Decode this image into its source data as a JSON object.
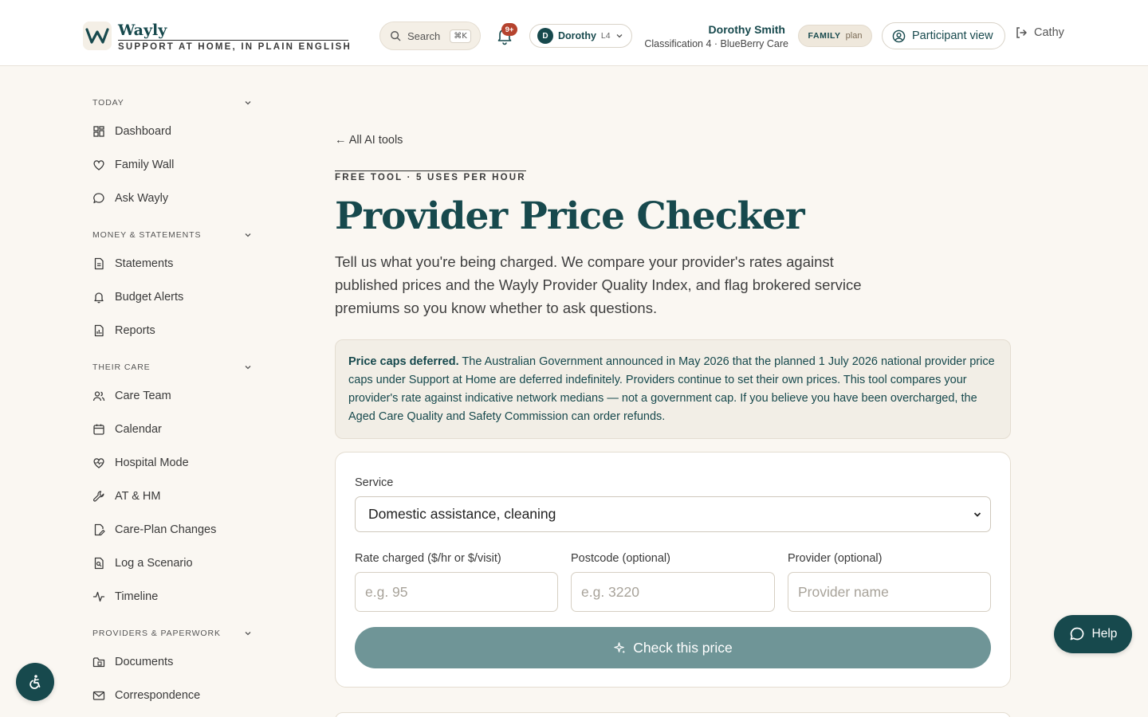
{
  "colors": {
    "brand": "#17494d",
    "background": "#faf7f2",
    "badge": "#b5432e",
    "button_disabled": "#6f9597"
  },
  "header": {
    "logo_icon": "wayly-w-logo",
    "app_name": "Wayly",
    "tagline": "SUPPORT AT HOME, IN PLAIN ENGLISH",
    "search": {
      "label": "Search",
      "shortcut": "⌘K",
      "icon": "search-icon"
    },
    "notifications": {
      "icon": "bell-icon",
      "badge": "9+"
    },
    "participant_switcher": {
      "initial": "D",
      "name": "Dorothy",
      "level": "L4",
      "icon": "chevron-down-icon"
    },
    "user": {
      "name": "Dorothy Smith",
      "subtitle": "Classification 4 · BlueBerry Care"
    },
    "plan": {
      "tier": "FAMILY",
      "label": "plan"
    },
    "participant_view": {
      "label": "Participant view",
      "icon": "user-circle-icon"
    },
    "logout": {
      "label": "Cathy",
      "icon": "logout-icon"
    }
  },
  "sidebar": {
    "sections": [
      {
        "title": "TODAY",
        "items": [
          {
            "label": "Dashboard",
            "icon": "dashboard-icon"
          },
          {
            "label": "Family Wall",
            "icon": "heart-icon"
          },
          {
            "label": "Ask Wayly",
            "icon": "chat-bubble-icon"
          }
        ]
      },
      {
        "title": "MONEY & STATEMENTS",
        "items": [
          {
            "label": "Statements",
            "icon": "document-icon"
          },
          {
            "label": "Budget Alerts",
            "icon": "bell-icon"
          },
          {
            "label": "Reports",
            "icon": "report-icon"
          }
        ]
      },
      {
        "title": "THEIR CARE",
        "items": [
          {
            "label": "Care Team",
            "icon": "users-icon"
          },
          {
            "label": "Calendar",
            "icon": "calendar-icon"
          },
          {
            "label": "Hospital Mode",
            "icon": "heart-pulse-icon"
          },
          {
            "label": "AT & HM",
            "icon": "wrench-icon"
          },
          {
            "label": "Care-Plan Changes",
            "icon": "edit-document-icon"
          },
          {
            "label": "Log a Scenario",
            "icon": "scenario-icon"
          },
          {
            "label": "Timeline",
            "icon": "activity-icon"
          }
        ]
      },
      {
        "title": "PROVIDERS & PAPERWORK",
        "items": [
          {
            "label": "Documents",
            "icon": "folder-icon"
          },
          {
            "label": "Correspondence",
            "icon": "mail-icon"
          }
        ]
      }
    ]
  },
  "main": {
    "back_link": "← All AI tools",
    "eyebrow": "FREE TOOL · 5 USES PER HOUR",
    "title": "Provider Price Checker",
    "intro": "Tell us what you're being charged. We compare your provider's rates against published prices and the Wayly Provider Quality Index, and flag brokered service premiums so you know whether to ask questions.",
    "notice": {
      "heading": "Price caps deferred.",
      "body": "The Australian Government announced in May 2026 that the planned 1 July 2026 national provider price caps under Support at Home are deferred indefinitely. Providers continue to set their own prices. This tool compares your provider's rate against indicative network medians — not a government cap. If you believe you have been overcharged, the Aged Care Quality and Safety Commission can order refunds."
    },
    "form": {
      "service_label": "Service",
      "service_value": "Domestic assistance, cleaning",
      "rate_label": "Rate charged ($/hr or $/visit)",
      "rate_placeholder": "e.g. 95",
      "postcode_label": "Postcode (optional)",
      "postcode_placeholder": "e.g. 3220",
      "provider_label": "Provider (optional)",
      "provider_placeholder": "Provider name",
      "submit_label": "Check this price",
      "submit_icon": "sparkle-icon"
    }
  },
  "help_button": {
    "label": "Help",
    "icon": "chat-bubble-icon"
  },
  "accessibility_button": {
    "icon": "accessibility-icon"
  }
}
